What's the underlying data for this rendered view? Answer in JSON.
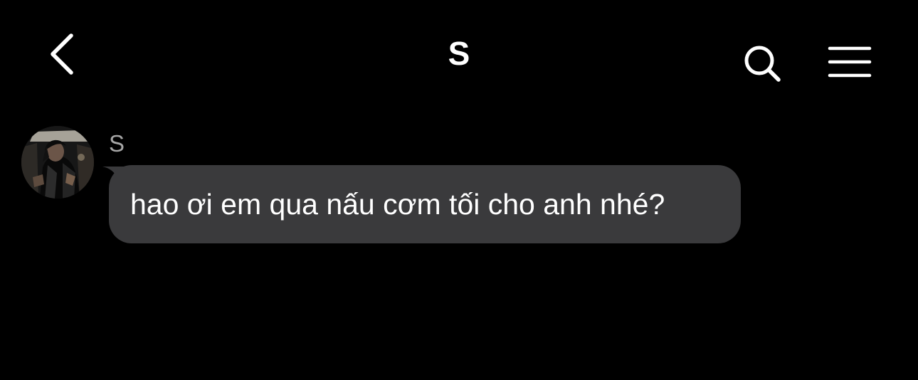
{
  "header": {
    "title": "S",
    "back_icon": "chevron-left-icon",
    "search_icon": "search-icon",
    "menu_icon": "hamburger-menu-icon"
  },
  "conversation": {
    "messages": [
      {
        "sender": "S",
        "avatar": "contact-avatar-photo",
        "text": "hao ơi em qua nấu cơm tối cho anh nhé?"
      }
    ]
  },
  "colors": {
    "background": "#000000",
    "bubble": "#3a3a3c",
    "sender_name": "#a6a6a6",
    "text": "#ffffff"
  }
}
